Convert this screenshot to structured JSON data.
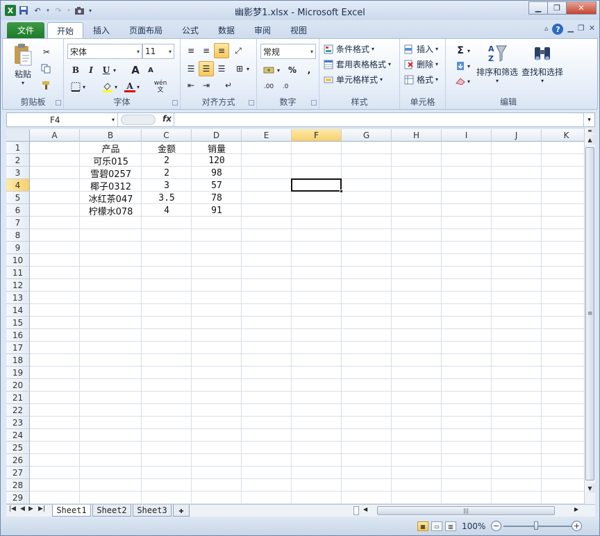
{
  "window": {
    "title": "幽影梦1.xlsx - Microsoft Excel",
    "app_icon": "X"
  },
  "ribbon_tabs": [
    {
      "label": "文件"
    },
    {
      "label": "开始"
    },
    {
      "label": "插入"
    },
    {
      "label": "页面布局"
    },
    {
      "label": "公式"
    },
    {
      "label": "数据"
    },
    {
      "label": "审阅"
    },
    {
      "label": "视图"
    }
  ],
  "ribbon": {
    "clipboard": {
      "label": "剪贴板",
      "paste": "粘贴"
    },
    "font": {
      "label": "字体",
      "font_name": "宋体",
      "font_size": "11",
      "bold": "B",
      "italic": "I",
      "underline": "U",
      "grow": "A",
      "shrink": "A",
      "color_letter": "A",
      "wen": "wén 文"
    },
    "alignment": {
      "label": "对齐方式"
    },
    "number": {
      "label": "数字",
      "format": "常规",
      "percent": "%",
      "comma": ",",
      "inc": ".00",
      "dec": ".0"
    },
    "styles": {
      "label": "样式",
      "conditional": "条件格式",
      "table": "套用表格格式",
      "cell_styles": "单元格样式"
    },
    "cells": {
      "label": "单元格",
      "insert": "插入",
      "delete": "删除",
      "format": "格式"
    },
    "editing": {
      "label": "编辑",
      "sum": "Σ",
      "sort": "排序和筛选",
      "find": "查找和选择"
    }
  },
  "formula_bar": {
    "name_box": "F4",
    "fx": "fx",
    "content": ""
  },
  "columns": [
    "A",
    "B",
    "C",
    "D",
    "E",
    "F",
    "G",
    "H",
    "I",
    "J",
    "K"
  ],
  "rows": [
    "1",
    "2",
    "3",
    "4",
    "5",
    "6",
    "7",
    "8",
    "9",
    "10",
    "11",
    "12",
    "13",
    "14",
    "15",
    "16",
    "17",
    "18",
    "19",
    "20",
    "21",
    "22",
    "23",
    "24",
    "25",
    "26",
    "27",
    "28",
    "29"
  ],
  "selected_cell": "F4",
  "table": {
    "headers": [
      "产品",
      "金额",
      "销量"
    ],
    "rows": [
      [
        "可乐015",
        "2",
        "120"
      ],
      [
        "雪碧0257",
        "2",
        "98"
      ],
      [
        "椰子0312",
        "3",
        "57"
      ],
      [
        "冰红茶047",
        "3.5",
        "78"
      ],
      [
        "柠檬水078",
        "4",
        "91"
      ]
    ]
  },
  "sheets": [
    {
      "name": "Sheet1",
      "active": true
    },
    {
      "name": "Sheet2",
      "active": false
    },
    {
      "name": "Sheet3",
      "active": false
    }
  ],
  "status": {
    "zoom": "100%"
  }
}
